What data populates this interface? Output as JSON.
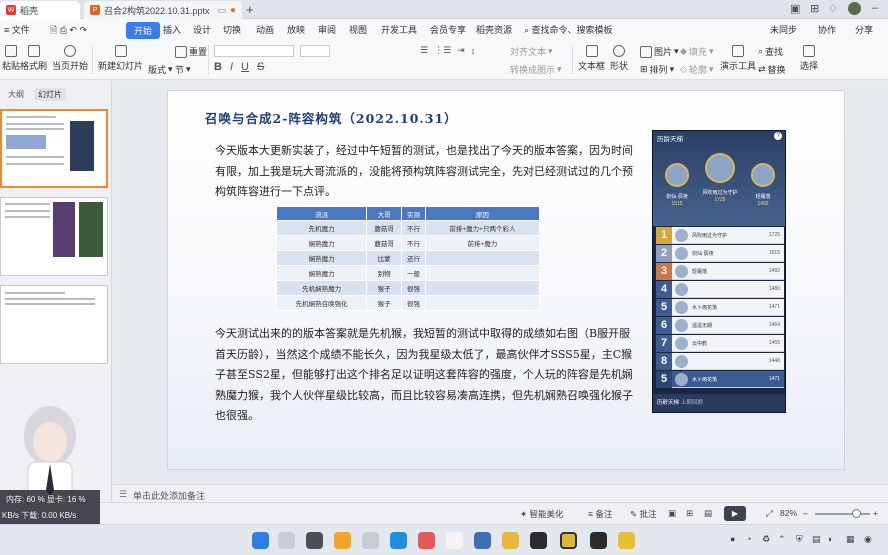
{
  "tabs": {
    "home_label": "稻壳",
    "doc_label": "召合2构筑2022.10.31.pptx"
  },
  "menu": {
    "items": [
      "开始",
      "插入",
      "设计",
      "切换",
      "动画",
      "放映",
      "审阅",
      "视图",
      "开发工具",
      "会员专享",
      "稻壳资源"
    ],
    "search_placeholder": "查找命令、搜索模板",
    "right": [
      "未同步",
      "协作",
      "分享"
    ]
  },
  "ribbon": {
    "paste": "粘贴",
    "format_painter": "格式刷",
    "play_from_current": "当页开始",
    "new_slide": "新建幻灯片",
    "layout": "版式",
    "section": "节",
    "reset": "重置",
    "text_direction": "对齐文本",
    "convert_smartart": "转换成图示",
    "textbox": "文本框",
    "shape": "形状",
    "image": "图片",
    "fill": "填充",
    "arrange": "排列",
    "outline": "轮廓",
    "slideshow_tools": "演示工具",
    "find": "查找",
    "replace": "替换",
    "select": "选择"
  },
  "left_panel": {
    "tab_outline": "大纲",
    "tab_slides": "幻灯片"
  },
  "slide": {
    "title": "召唤与合成2-阵容构筑（2022.10.31）",
    "paragraph1": "今天版本大更新实装了，经过中午短暂的测试，也是找出了今天的版本答案，因为时间有限，加上我是玩大哥流派的，没能将预构筑阵容测试完全，先对已经测试过的几个预构筑阵容进行一下点评。",
    "paragraph2": "今天测试出来的的版本答案就是先机猴，我短暂的测试中取得的成绩如右图（B服开服首天历龄），当然这个成绩不能长久，因为我星级太低了，最高伙伴才SSS5星，主C猴子甚至SS2星，但能够打出这个排名足以证明这套阵容的强度，个人玩的阵容是先机娴熟魔力猴，我个人伙伴星级比较高，而且比较容易凑高连携，但先机娴熟召唤强化猴子也很强。",
    "table": {
      "headers": [
        "流派",
        "大哥",
        "实测",
        "原因"
      ],
      "rows": [
        [
          "先机魔力",
          "蘑菇哥",
          "不行",
          "前排+魔力+只两个彩人"
        ],
        [
          "娴熟魔力",
          "蘑菇哥",
          "不行",
          "前排+魔力"
        ],
        [
          "娴熟魔力",
          "比蒙",
          "还行",
          ""
        ],
        [
          "娴熟魔力",
          "别物",
          "一般",
          ""
        ],
        [
          "先机娴熟魔力",
          "猴子",
          "很强",
          ""
        ],
        [
          "先机娴熟召唤强化",
          "猴子",
          "很强",
          ""
        ]
      ]
    }
  },
  "game": {
    "header": "历龄天梯",
    "help": "?",
    "podium": [
      {
        "name": "剑仙·辰夜",
        "score": "1515"
      },
      {
        "name": "风吹雨过为守护",
        "score": "1725"
      },
      {
        "name": "轻霜落",
        "score": "1492"
      }
    ],
    "ranks": [
      {
        "num": "1",
        "name": "风吹雨过为守护",
        "score": "1725"
      },
      {
        "name": "剑仙·辰夜",
        "num": "2",
        "score": "1515"
      },
      {
        "num": "3",
        "name": "轻霜落",
        "score": "1492"
      },
      {
        "num": "4",
        "name": "",
        "score": "1480"
      },
      {
        "num": "5",
        "name": "水卜雨花落",
        "score": "1471"
      },
      {
        "num": "6",
        "name": "遥遥无期",
        "score": "1464"
      },
      {
        "num": "7",
        "name": "云中鹤",
        "score": "1455"
      },
      {
        "num": "8",
        "name": "",
        "score": "1448"
      },
      {
        "num": "9",
        "name": "",
        "score": ""
      }
    ],
    "self_rank": "5",
    "self_name": "水卜雨花落",
    "self_score": "1471",
    "tab_ladder": "历龄天梯",
    "tab_season": "上期回顾"
  },
  "notes": {
    "placeholder": "单击此处添加备注"
  },
  "status": {
    "smart_beautify": "智能美化",
    "notes": "备注",
    "comments": "批注",
    "zoom": "82%"
  },
  "overlay": {
    "memory": "内存: 60 %",
    "gpu": "显卡: 16 %",
    "net_up": "KB/s",
    "net_down": "下载: 0.00 KB/s"
  },
  "taskbar": {
    "time": ""
  }
}
